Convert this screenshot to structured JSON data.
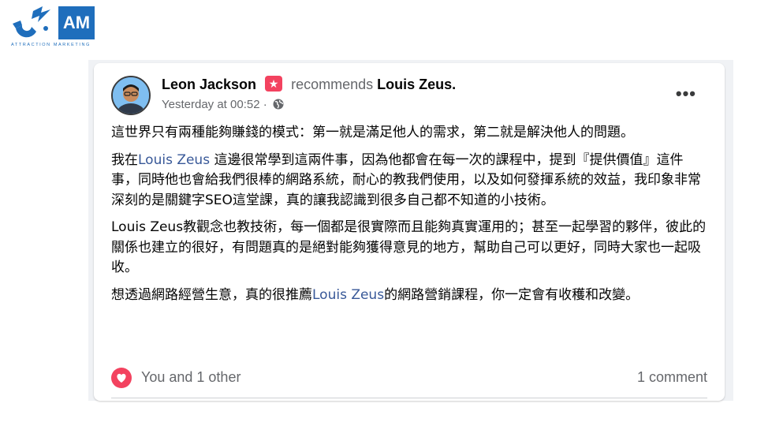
{
  "brand": {
    "logo_initials": "AM",
    "logo_tagline": "ATTRACTION MARKETING",
    "accent_color": "#1f6ebc"
  },
  "post": {
    "author": "Leon Jackson",
    "recommends_label": "recommends",
    "target": "Louis Zeus.",
    "timestamp": "Yesterday at 00:52 ·",
    "more_label": "•••",
    "paragraphs": [
      {
        "segments": [
          {
            "text": "這世界只有兩種能夠賺錢的模式：第一就是滿足他人的需求，第二就是解決他人的問題。",
            "link": false
          }
        ]
      },
      {
        "segments": [
          {
            "text": "我在",
            "link": false
          },
          {
            "text": "Louis Zeus",
            "link": true
          },
          {
            "text": " 這邊很常學到這兩件事，因為他都會在每一次的課程中，提到『提供價值』這件事，同時他也會給我們很棒的網路系統，耐心的教我們使用，以及如何發揮系統的效益，我印象非常深刻的是關鍵字SEO這堂課，真的讓我認識到很多自己都不知道的小技術。",
            "link": false
          }
        ]
      },
      {
        "segments": [
          {
            "text": "Louis Zeus教觀念也教技術，每一個都是很實際而且能夠真實運用的；甚至一起學習的夥伴，彼此的關係也建立的很好，有問題真的是絕對能夠獲得意見的地方，幫助自己可以更好，同時大家也一起吸收。",
            "link": false
          }
        ]
      },
      {
        "segments": [
          {
            "text": "想透過網路經營生意，真的很推薦",
            "link": false
          },
          {
            "text": "Louis Zeus",
            "link": true
          },
          {
            "text": "的網路營銷課程，你一定會有收穫和改變。",
            "link": false
          }
        ]
      }
    ],
    "reactions_text": "You and 1 other",
    "comments_text": "1 comment",
    "icons": {
      "recommend": "star-icon",
      "privacy": "globe-icon",
      "reaction": "heart-icon"
    },
    "colors": {
      "name": "#050505",
      "secondary": "#65676b",
      "link": "#385898",
      "reaction": "#f3425f"
    }
  }
}
